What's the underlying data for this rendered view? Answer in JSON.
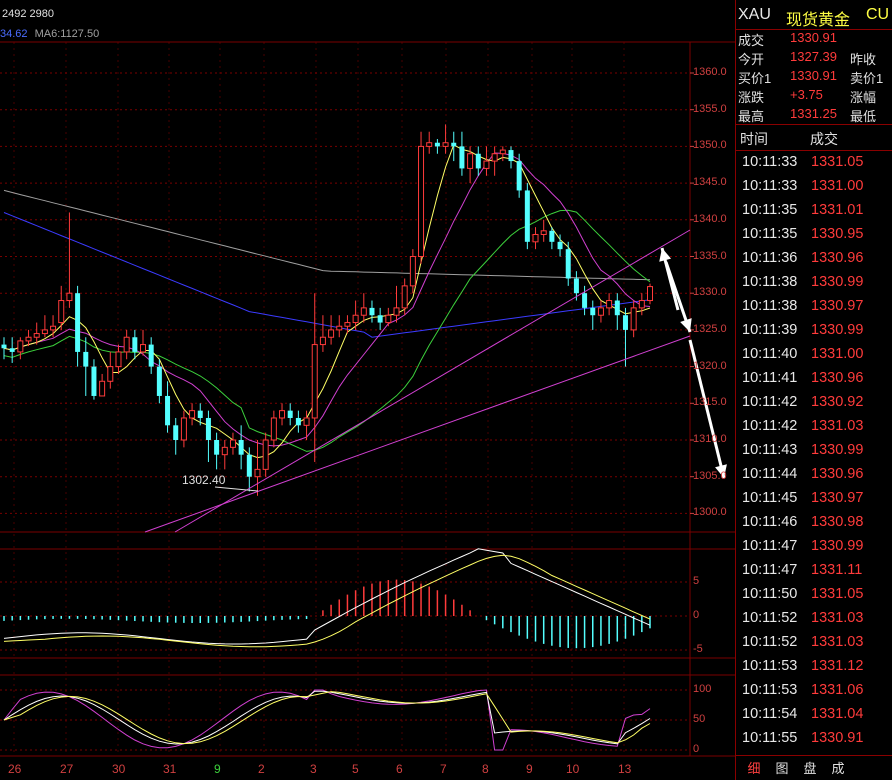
{
  "header": {
    "top_values": "2492 2980",
    "ma_values_prefix": "34.62",
    "ma6": "MA6:1127.50"
  },
  "price_axis": [
    "1360.0",
    "1355.0",
    "1350.0",
    "1345.0",
    "1340.0",
    "1335.0",
    "1330.0",
    "1325.0",
    "1320.0",
    "1315.0",
    "1310.0",
    "1305.0",
    "1300.0"
  ],
  "macd_axis": [
    "5",
    "0",
    "-5"
  ],
  "kd_axis": [
    "100",
    "50",
    "0"
  ],
  "x_axis": [
    "26",
    "27",
    "30",
    "31",
    "9",
    "2",
    "3",
    "5",
    "6",
    "7",
    "8",
    "9",
    "10",
    "13"
  ],
  "annotation_low": "1302.40",
  "quote": {
    "symbol": "XAU",
    "name": "现货黄金",
    "code_partial": "CU",
    "rows": [
      {
        "label": "成交",
        "value": "1330.91",
        "label2": ""
      },
      {
        "label": "今开",
        "value": "1327.39",
        "label2": "昨收"
      },
      {
        "label": "买价1",
        "value": "1330.91",
        "label2": "卖价1"
      },
      {
        "label": "涨跌",
        "value": "+3.75",
        "label2": "涨幅"
      },
      {
        "label": "最高",
        "value": "1331.25",
        "label2": "最低"
      }
    ],
    "trades_header": {
      "time": "时间",
      "price": "成交"
    },
    "trades": [
      {
        "time": "10:11:33",
        "price": "1331.05"
      },
      {
        "time": "10:11:33",
        "price": "1331.00"
      },
      {
        "time": "10:11:35",
        "price": "1331.01"
      },
      {
        "time": "10:11:35",
        "price": "1330.95"
      },
      {
        "time": "10:11:36",
        "price": "1330.96"
      },
      {
        "time": "10:11:38",
        "price": "1330.99"
      },
      {
        "time": "10:11:38",
        "price": "1330.97"
      },
      {
        "time": "10:11:39",
        "price": "1330.99"
      },
      {
        "time": "10:11:40",
        "price": "1331.00"
      },
      {
        "time": "10:11:41",
        "price": "1330.96"
      },
      {
        "time": "10:11:42",
        "price": "1330.92"
      },
      {
        "time": "10:11:42",
        "price": "1331.03"
      },
      {
        "time": "10:11:43",
        "price": "1330.99"
      },
      {
        "time": "10:11:44",
        "price": "1330.96"
      },
      {
        "time": "10:11:45",
        "price": "1330.97"
      },
      {
        "time": "10:11:46",
        "price": "1330.98"
      },
      {
        "time": "10:11:47",
        "price": "1330.99"
      },
      {
        "time": "10:11:47",
        "price": "1331.11"
      },
      {
        "time": "10:11:50",
        "price": "1331.05"
      },
      {
        "time": "10:11:52",
        "price": "1331.03"
      },
      {
        "time": "10:11:52",
        "price": "1331.03"
      },
      {
        "time": "10:11:53",
        "price": "1331.12"
      },
      {
        "time": "10:11:53",
        "price": "1331.06"
      },
      {
        "time": "10:11:54",
        "price": "1331.04"
      },
      {
        "time": "10:11:55",
        "price": "1330.91"
      }
    ],
    "tabs": [
      "细",
      "图",
      "盘",
      "成"
    ]
  },
  "colors": {
    "up": "#ff3b3b",
    "down": "#54ffff",
    "grid": "#7a0000",
    "axis_text": "#d04040",
    "ma_yellow": "#ffff66",
    "ma_magenta": "#d040d0",
    "ma_green": "#3cd03c",
    "ma_blue": "#3b3bff",
    "ma_gray": "#a0a0a0"
  },
  "candles": [
    [
      1323,
      1322.5,
      1324,
      1321
    ],
    [
      1322.5,
      1322,
      1324,
      1320.5
    ],
    [
      1322,
      1323.5,
      1324,
      1321
    ],
    [
      1323.5,
      1324,
      1325,
      1322.8
    ],
    [
      1324,
      1324.5,
      1326,
      1323
    ],
    [
      1324.5,
      1325,
      1327,
      1324
    ],
    [
      1325,
      1325.5,
      1327,
      1324
    ],
    [
      1326,
      1329,
      1331,
      1325
    ],
    [
      1329,
      1330,
      1341,
      1328
    ],
    [
      1330,
      1322,
      1331,
      1320
    ],
    [
      1322,
      1320,
      1324,
      1316
    ],
    [
      1320,
      1316,
      1321,
      1315.5
    ],
    [
      1316,
      1318,
      1319,
      1316
    ],
    [
      1318,
      1320,
      1322,
      1317
    ],
    [
      1320,
      1322,
      1323,
      1319
    ],
    [
      1322,
      1324,
      1325,
      1321
    ],
    [
      1324,
      1322,
      1325,
      1321
    ],
    [
      1322,
      1323,
      1325,
      1321.5
    ],
    [
      1323,
      1320,
      1324,
      1319
    ],
    [
      1320,
      1316,
      1321,
      1315
    ],
    [
      1316,
      1312,
      1318,
      1311
    ],
    [
      1312,
      1310,
      1313,
      1308
    ],
    [
      1310,
      1313,
      1314,
      1309
    ],
    [
      1313,
      1314,
      1315,
      1312
    ],
    [
      1314,
      1313,
      1315,
      1312
    ],
    [
      1313,
      1310,
      1314,
      1307
    ],
    [
      1310,
      1308,
      1311,
      1306
    ],
    [
      1308,
      1309,
      1310,
      1306
    ],
    [
      1309,
      1310,
      1311,
      1308
    ],
    [
      1310,
      1308,
      1312,
      1306
    ],
    [
      1308,
      1305,
      1309,
      1303
    ],
    [
      1305,
      1306,
      1310,
      1302.4
    ],
    [
      1306,
      1310,
      1311,
      1305
    ],
    [
      1310,
      1313,
      1314,
      1309
    ],
    [
      1313,
      1314,
      1315,
      1312
    ],
    [
      1314,
      1313,
      1315,
      1312
    ],
    [
      1313,
      1312,
      1314,
      1311
    ],
    [
      1312,
      1313,
      1314,
      1310
    ],
    [
      1313,
      1323,
      1330,
      1307
    ],
    [
      1323,
      1324,
      1327,
      1322
    ],
    [
      1324,
      1325,
      1327,
      1323
    ],
    [
      1325,
      1325.5,
      1327,
      1324
    ],
    [
      1325.5,
      1326,
      1327,
      1324.5
    ],
    [
      1326,
      1327,
      1329,
      1325
    ],
    [
      1327,
      1328,
      1330,
      1326
    ],
    [
      1328,
      1327,
      1329,
      1326
    ],
    [
      1327,
      1326,
      1328,
      1325
    ],
    [
      1326,
      1327,
      1328,
      1325.5
    ],
    [
      1327,
      1328,
      1331,
      1326
    ],
    [
      1328,
      1331,
      1332,
      1327
    ],
    [
      1331,
      1335,
      1336,
      1330
    ],
    [
      1335,
      1350,
      1352,
      1334
    ],
    [
      1350,
      1350.5,
      1352,
      1349
    ],
    [
      1350.5,
      1350,
      1351,
      1349
    ],
    [
      1350,
      1350.5,
      1353,
      1349
    ],
    [
      1350.5,
      1350,
      1352,
      1348
    ],
    [
      1350,
      1347,
      1352,
      1346
    ],
    [
      1347,
      1349,
      1350,
      1345
    ],
    [
      1349,
      1347,
      1350,
      1346
    ],
    [
      1347,
      1348,
      1350,
      1346
    ],
    [
      1348,
      1349,
      1350,
      1346
    ],
    [
      1349,
      1349.5,
      1350,
      1348
    ],
    [
      1349.5,
      1348,
      1350,
      1347
    ],
    [
      1348,
      1344,
      1349,
      1343
    ],
    [
      1344,
      1337,
      1345,
      1336
    ],
    [
      1337,
      1338,
      1339,
      1336
    ],
    [
      1338,
      1338.5,
      1340,
      1337
    ],
    [
      1338.5,
      1337,
      1339,
      1336
    ],
    [
      1337,
      1336,
      1338,
      1335
    ],
    [
      1336,
      1332,
      1337,
      1331
    ],
    [
      1332,
      1330,
      1333,
      1329
    ],
    [
      1330,
      1328,
      1331,
      1327
    ],
    [
      1328,
      1327,
      1329,
      1325
    ],
    [
      1327,
      1328,
      1329,
      1326
    ],
    [
      1328,
      1329,
      1330,
      1327
    ],
    [
      1329,
      1327,
      1330,
      1325
    ],
    [
      1327,
      1325,
      1328,
      1320
    ],
    [
      1325,
      1328,
      1329,
      1324
    ],
    [
      1328,
      1329,
      1330,
      1327
    ],
    [
      1329,
      1330.9,
      1331.3,
      1328.5
    ]
  ]
}
